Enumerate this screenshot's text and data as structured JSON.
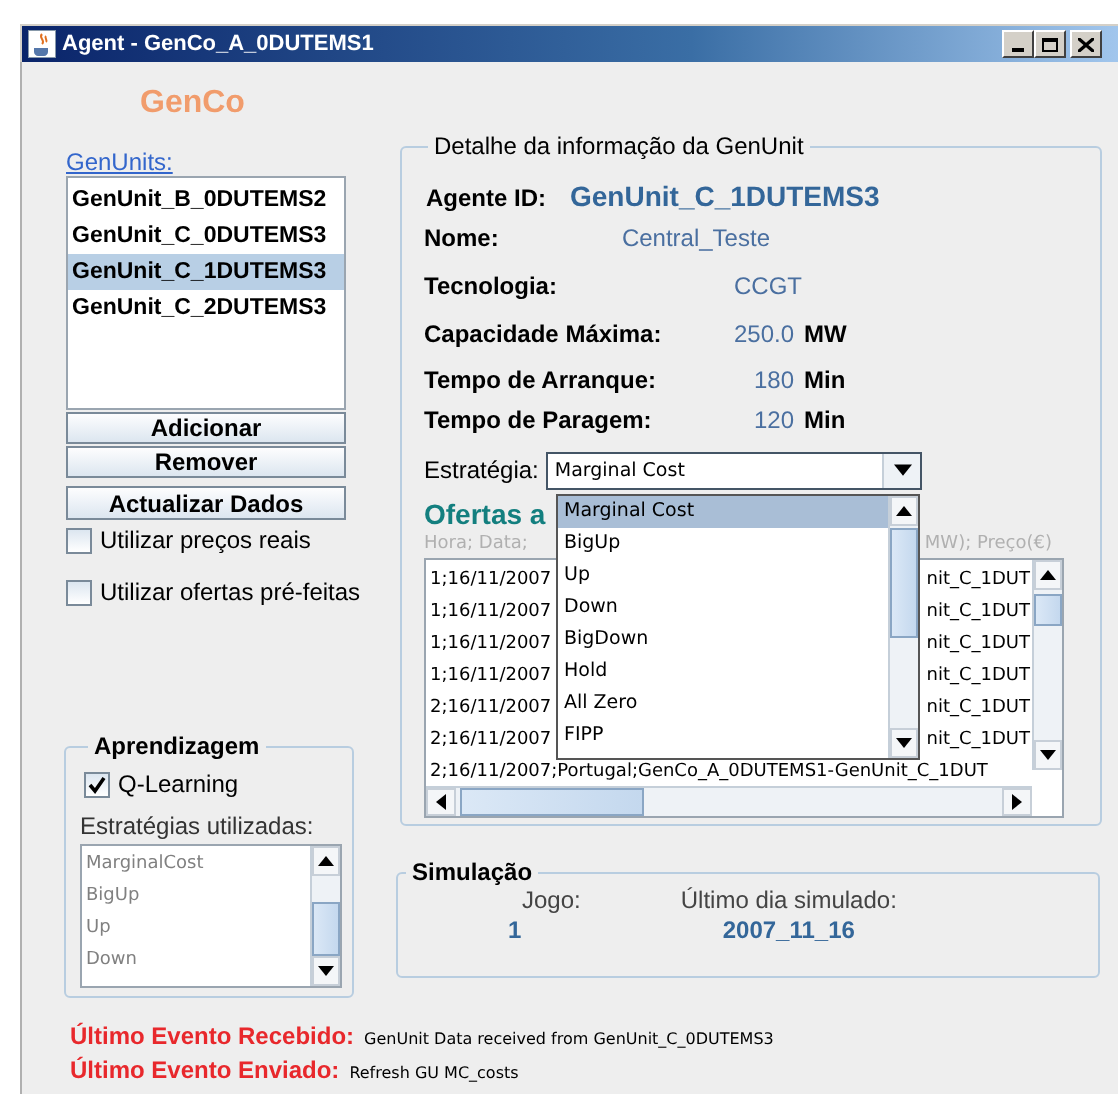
{
  "window": {
    "title": "Agent - GenCo_A_0DUTEMS1"
  },
  "company": "GenCo",
  "genunits": {
    "title": "GenUnits:",
    "items": [
      {
        "label": "GenUnit_B_0DUTEMS2",
        "selected": false
      },
      {
        "label": "GenUnit_C_0DUTEMS3",
        "selected": false
      },
      {
        "label": "GenUnit_C_1DUTEMS3",
        "selected": true
      },
      {
        "label": "GenUnit_C_2DUTEMS3",
        "selected": false
      }
    ]
  },
  "buttons": [
    "Adicionar",
    "Remover",
    "Actualizar Dados"
  ],
  "options": [
    {
      "label": "Utilizar preços reais",
      "checked": false
    },
    {
      "label": "Utilizar ofertas pré-feitas",
      "checked": false
    }
  ],
  "learning": {
    "title": "Aprendizagem",
    "q_learning": {
      "label": "Q-Learning",
      "checked": true
    },
    "strategies_label": "Estratégias utilizadas:",
    "strategies": [
      "MarginalCost",
      "BigUp",
      "Up",
      "Down"
    ]
  },
  "details": {
    "title": "Detalhe da informação da GenUnit",
    "fields": [
      {
        "kind": "id",
        "label": "Agente ID:",
        "value": "GenUnit_C_1DUTEMS3"
      },
      {
        "kind": "text",
        "label": "Nome:",
        "value": "Central_Teste"
      },
      {
        "kind": "text",
        "label": "Tecnologia:",
        "value": "CCGT"
      },
      {
        "kind": "number",
        "label": "Capacidade Máxima:",
        "value": "250.0",
        "unit": "MW"
      },
      {
        "kind": "number",
        "label": "Tempo de Arranque:",
        "value": "180",
        "unit": "Min"
      },
      {
        "kind": "number",
        "label": "Tempo de Paragem:",
        "value": "120",
        "unit": "Min"
      }
    ],
    "strategy": {
      "label": "Estratégia:",
      "value": "Marginal Cost",
      "expanded": true,
      "options": [
        {
          "label": "Marginal Cost",
          "selected": true
        },
        {
          "label": "BigUp",
          "selected": false
        },
        {
          "label": "Up",
          "selected": false
        },
        {
          "label": "Down",
          "selected": false
        },
        {
          "label": "BigDown",
          "selected": false
        },
        {
          "label": "Hold",
          "selected": false
        },
        {
          "label": "All Zero",
          "selected": false
        },
        {
          "label": "FIPP",
          "selected": false
        }
      ]
    },
    "offers": {
      "title": "Ofertas a",
      "header_left": "Hora;  Data;",
      "header_right": "MW);  Preço(€)",
      "rows": [
        {
          "left": "1;16/11/2007",
          "right": "nit_C_1DUT"
        },
        {
          "left": "1;16/11/2007",
          "right": "nit_C_1DUT"
        },
        {
          "left": "1;16/11/2007",
          "right": "nit_C_1DUT"
        },
        {
          "left": "1;16/11/2007",
          "right": "nit_C_1DUT"
        },
        {
          "left": "2;16/11/2007",
          "right": "nit_C_1DUT"
        },
        {
          "left": "2;16/11/2007",
          "right": "nit_C_1DUT"
        },
        {
          "left": "2;16/11/2007;Portugal;GenCo_A_0DUTEMS1-GenUnit_C_1DUT",
          "right": ""
        }
      ]
    }
  },
  "simulation": {
    "title": "Simulação",
    "game_label": "Jogo:",
    "game": "1",
    "last_day_label": "Último dia simulado:",
    "last_day": "2007_11_16"
  },
  "events": [
    {
      "label": "Último Evento Recebido:",
      "message": "GenUnit Data received from GenUnit_C_0DUTEMS3"
    },
    {
      "label": "Último Evento Enviado:",
      "message": "Refresh GU MC_costs"
    }
  ]
}
